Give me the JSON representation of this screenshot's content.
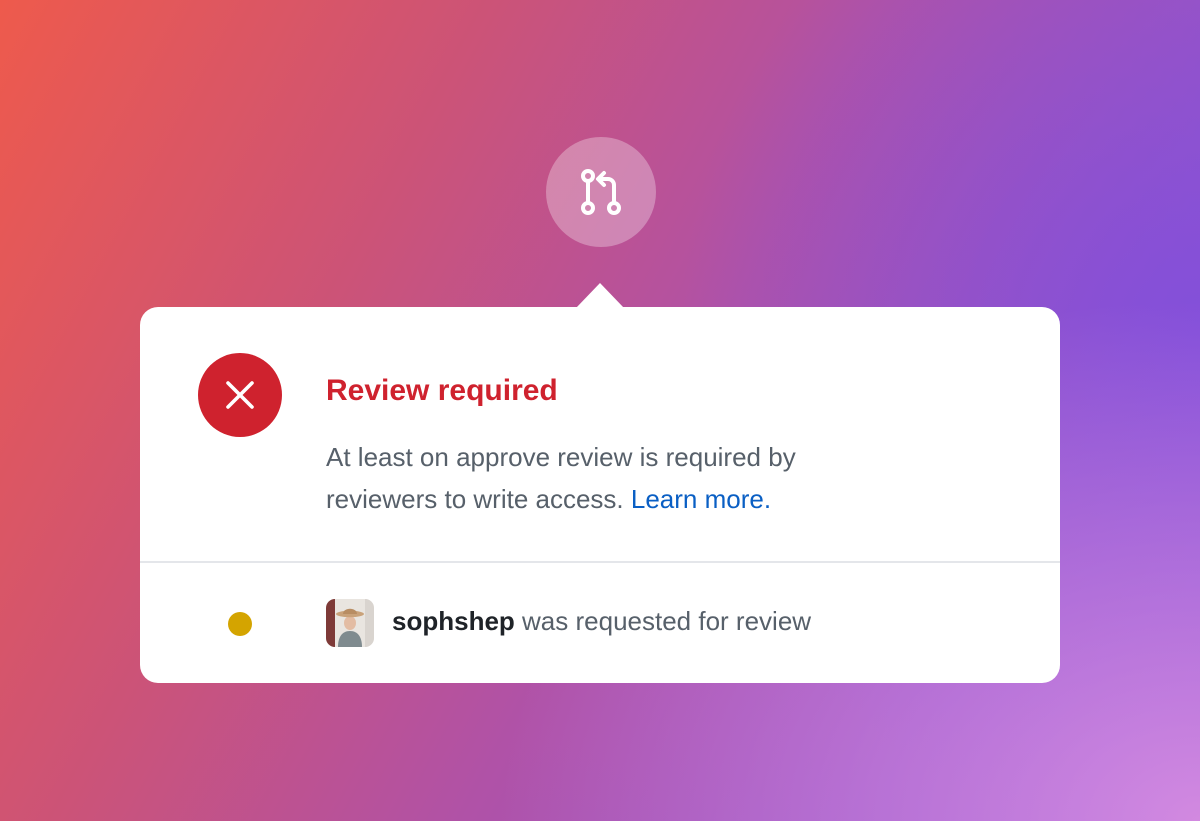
{
  "icons": {
    "badge": "git-pull-request-icon",
    "status": "x-icon",
    "reviewer_status": "pending-dot"
  },
  "colors": {
    "error": "#cf222e",
    "link": "#0a5fc4",
    "pending": "#d4a400"
  },
  "card": {
    "title": "Review required",
    "description": "At least on approve review is required by reviewers to write access.",
    "link_label": "Learn more."
  },
  "reviewer": {
    "username": "sophshep",
    "status_text": "was requested for review"
  }
}
